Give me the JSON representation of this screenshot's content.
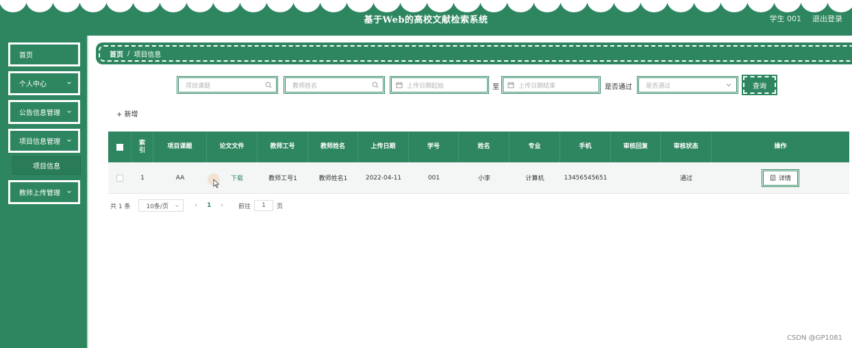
{
  "header": {
    "title": "基于Web的高校文献检索系统",
    "user": "学生 001",
    "logout": "退出登录"
  },
  "sidebar": {
    "items": [
      {
        "label": "首页"
      },
      {
        "label": "个人中心"
      },
      {
        "label": "公告信息管理"
      },
      {
        "label": "项目信息管理"
      },
      {
        "label": "项目信息"
      },
      {
        "label": "教师上传管理"
      }
    ]
  },
  "breadcrumb": {
    "home": "首页",
    "separator": "/",
    "current": "项目信息"
  },
  "search": {
    "project_placeholder": "项目课题",
    "teacher_placeholder": "教师姓名",
    "date_start_placeholder": "上传日期起始",
    "to_label": "至",
    "date_end_placeholder": "上传日期结束",
    "approved_label": "是否通过",
    "approved_placeholder": "是否通过",
    "query_button": "查询"
  },
  "toolbar": {
    "add_label": "+ 新增"
  },
  "table": {
    "columns": [
      "",
      "索引",
      "项目课题",
      "论文文件",
      "教师工号",
      "教师姓名",
      "上传日期",
      "学号",
      "姓名",
      "专业",
      "手机",
      "审核回复",
      "审核状态",
      "操作"
    ],
    "rows": [
      {
        "index": "1",
        "project": "AA",
        "file_link": "下载",
        "teacher_id": "教师工号1",
        "teacher_name": "教师姓名1",
        "upload_date": "2022-04-11",
        "student_id": "001",
        "name": "小李",
        "major": "计算机",
        "phone": "13456545651",
        "reply": "",
        "status": "通过",
        "action": "详情"
      }
    ]
  },
  "pagination": {
    "total": "共 1 条",
    "page_size": "10条/页",
    "prev": "‹",
    "page": "1",
    "next": "›",
    "goto_label": "前往",
    "goto_value": "1",
    "page_suffix": "页"
  },
  "watermark": "CSDN @GP1081",
  "colors": {
    "primary": "#2e8660",
    "row_bg": "#f4f6f5"
  }
}
